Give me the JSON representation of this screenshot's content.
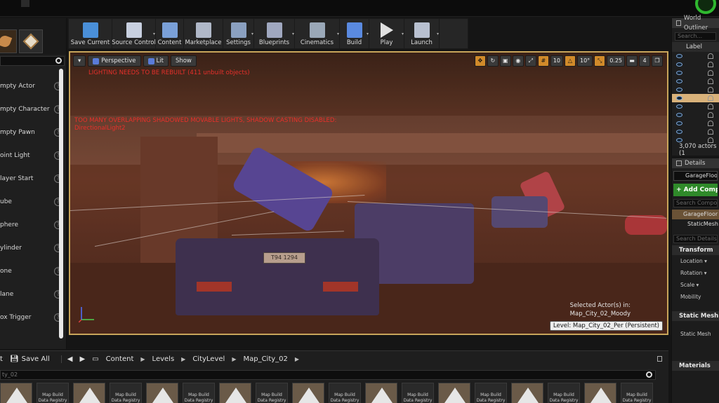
{
  "toolbar": [
    {
      "label": "Save Current",
      "icon": "save-icon"
    },
    {
      "label": "Source Control",
      "icon": "source-control-icon"
    },
    {
      "label": "Content",
      "icon": "content-icon"
    },
    {
      "label": "Marketplace",
      "icon": "marketplace-icon"
    },
    {
      "label": "Settings",
      "icon": "settings-icon"
    },
    {
      "label": "Blueprints",
      "icon": "blueprints-icon"
    },
    {
      "label": "Cinematics",
      "icon": "cinematics-icon"
    },
    {
      "label": "Build",
      "icon": "build-icon"
    },
    {
      "label": "Play",
      "icon": "play-icon"
    },
    {
      "label": "Launch",
      "icon": "launch-icon"
    }
  ],
  "modes": {
    "items": [
      "mpty Actor",
      "mpty Character",
      "mpty Pawn",
      "oint Light",
      "layer Start",
      "ube",
      "phere",
      "ylinder",
      "one",
      "lane",
      "ox Trigger"
    ],
    "help_glyph": "?"
  },
  "viewport": {
    "view_mode": "Perspective",
    "lit_mode": "Lit",
    "show_label": "Show",
    "warning_lighting": "LIGHTING NEEDS TO BE REBUILT (411 unbuilt objects)",
    "warning_shadow_1": "TOO MANY OVERLAPPING SHADOWED MOVABLE LIGHTS, SHADOW CASTING DISABLED:",
    "warning_shadow_2": "DirectionalLight2",
    "grid_snap": "10",
    "rotation_snap": "10°",
    "scale_snap": "0.25",
    "camera_speed": "4",
    "selected_label": "Selected Actor(s) in:",
    "selected_map": "Map_City_02_Moody",
    "level_label": "Level:  Map_City_02_Per (Persistent)",
    "plate_text": "T94 1294",
    "accent": "#c8a55a"
  },
  "outliner": {
    "title": "World Outliner",
    "search_placeholder": "Search...",
    "label_header": "Label",
    "actor_count": "3,070 actors (1"
  },
  "details": {
    "title": "Details",
    "object_name": "GarageFloor",
    "add_component": "+ Add Compo",
    "search_components": "Search Compon",
    "component_root": "GarageFloor",
    "component_child": "StaticMesh",
    "search_details": "Search Details",
    "transform": "Transform",
    "location": "Location ▾",
    "rotation": "Rotation ▾",
    "scale": "Scale ▾",
    "mobility": "Mobility",
    "static_mesh_section": "Static Mesh",
    "static_mesh_prop": "Static Mesh",
    "materials": "Materials"
  },
  "content_browser": {
    "import_stub": "t",
    "save_all": "Save All",
    "crumbs": [
      "Content",
      "Levels",
      "CityLevel",
      "Map_City_02"
    ],
    "search_text": "ty_02",
    "asset_label": "Map Build Data Registry"
  }
}
